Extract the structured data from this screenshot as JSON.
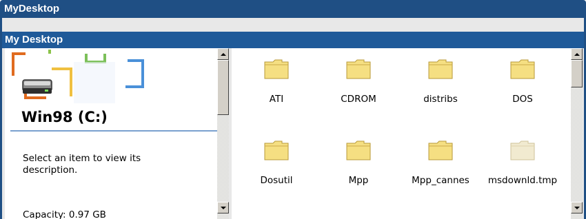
{
  "window": {
    "title": "MyDesktop"
  },
  "panel": {
    "title": "My Desktop"
  },
  "details": {
    "drive_label": "Win98 (C:)",
    "description": "Select an item to view its description.",
    "capacity": "Capacity: 0.97 GB"
  },
  "files": [
    {
      "name": "ATI",
      "icon": "folder-icon",
      "dimmed": false
    },
    {
      "name": "CDROM",
      "icon": "folder-icon",
      "dimmed": false
    },
    {
      "name": "distribs",
      "icon": "folder-icon",
      "dimmed": false
    },
    {
      "name": "DOS",
      "icon": "folder-icon",
      "dimmed": false
    },
    {
      "name": "Dosutil",
      "icon": "folder-icon",
      "dimmed": false
    },
    {
      "name": "Mpp",
      "icon": "folder-icon",
      "dimmed": false
    },
    {
      "name": "Mpp_cannes",
      "icon": "folder-icon",
      "dimmed": false
    },
    {
      "name": "msdownld.tmp",
      "icon": "folder-icon",
      "dimmed": true
    }
  ],
  "colors": {
    "titlebar": "#1f4f84",
    "folder": "#f5df82",
    "folder_dimmed": "#f1ead0"
  }
}
